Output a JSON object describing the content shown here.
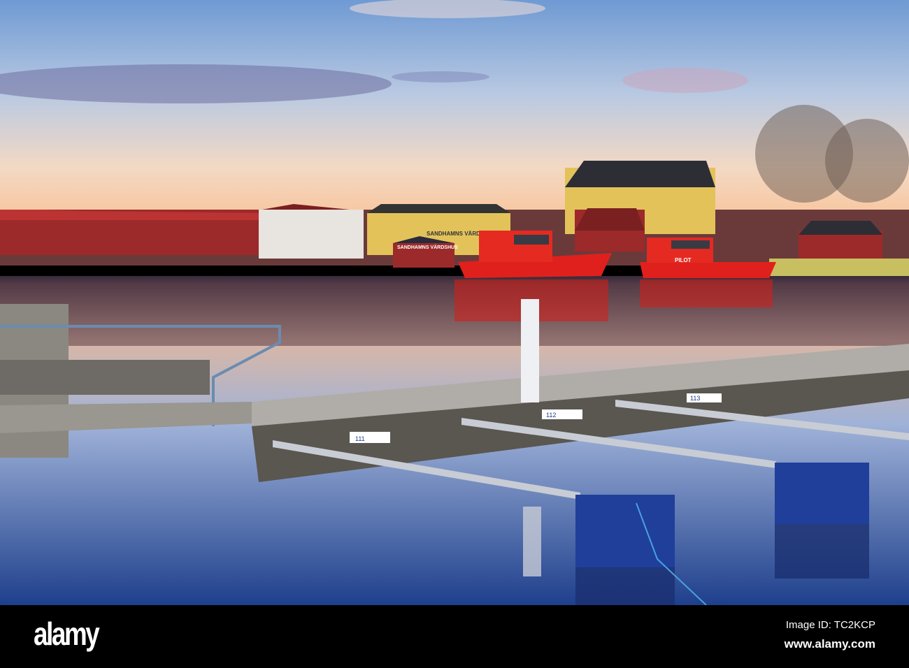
{
  "photo": {
    "signs": {
      "inn_upper": "SANDHAMNS VÄRDSHUS",
      "inn_lower": "SANDHAMNS VÄRDSHUS",
      "pilot_boat": "PILOT"
    },
    "berth_numbers": [
      "111",
      "112",
      "113"
    ]
  },
  "footer": {
    "logo": "alamy",
    "image_id": "Image ID: TC2KCP",
    "website": "www.alamy.com"
  },
  "colors": {
    "sky_top": "#7fa6d6",
    "sky_horizon": "#f6d6b8",
    "boat_red": "#e0201c",
    "house_yellow": "#e3c25a",
    "house_red": "#9c2a2a",
    "float_blue": "#1f3f9a"
  }
}
